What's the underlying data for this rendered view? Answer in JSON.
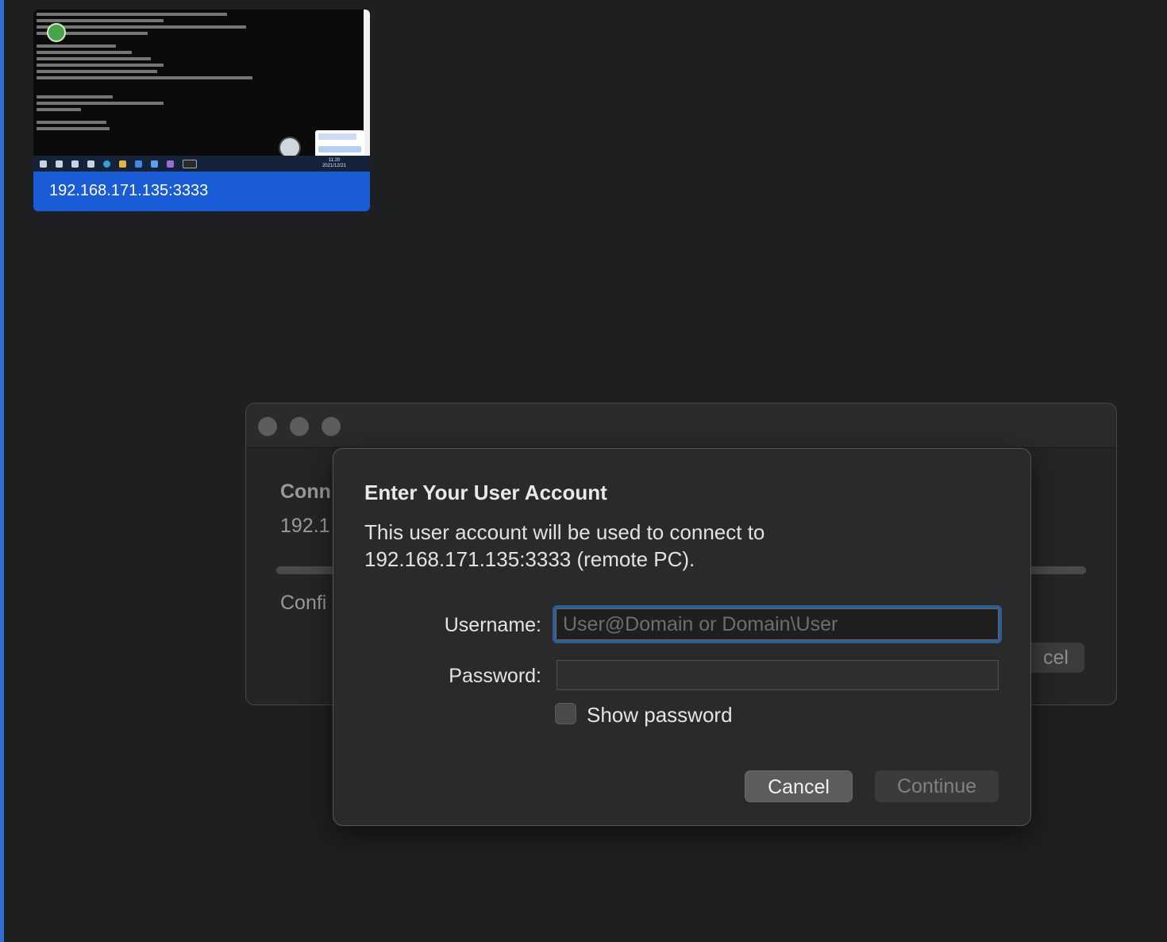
{
  "pc_tile": {
    "label": "192.168.171.135:3333",
    "clock_time": "11:20",
    "clock_date": "2021/12/21"
  },
  "background_window": {
    "connecting_text": "Conn",
    "address_text": "192.1",
    "status_text": "Confi",
    "cancel_label": "cel"
  },
  "dialog": {
    "title": "Enter Your User Account",
    "message_line1": "This user account will be used to connect to",
    "message_line2": "192.168.171.135:3333 (remote PC).",
    "username_label": "Username:",
    "username_placeholder": "User@Domain or Domain\\User",
    "username_value": "",
    "password_label": "Password:",
    "show_password_label": "Show password",
    "show_password_checked": false,
    "cancel_label": "Cancel",
    "continue_label": "Continue",
    "accent_color": "#2d5f93"
  }
}
